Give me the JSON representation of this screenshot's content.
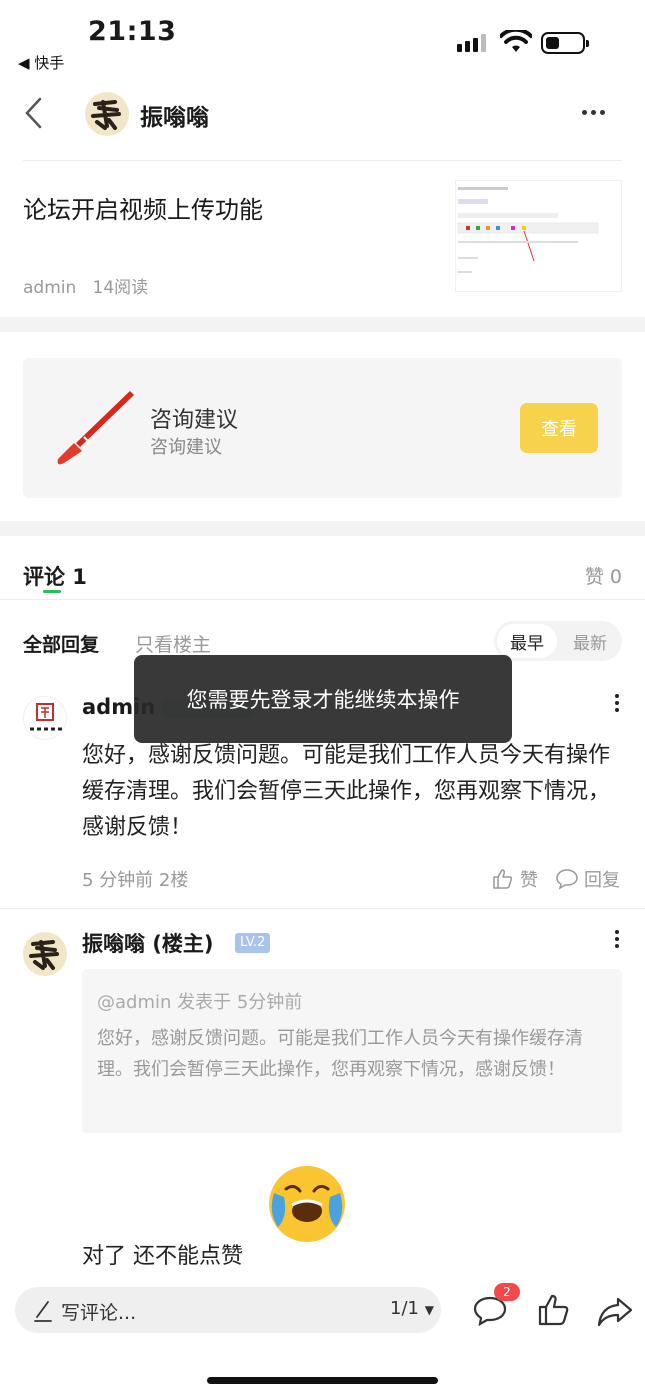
{
  "status_bar": {
    "time": "21:13",
    "back_app": "◀ 快手"
  },
  "header": {
    "user_name": "振嗡嗡"
  },
  "article": {
    "title": "论坛开启视频上传功能",
    "author": "admin",
    "reads": "14阅读"
  },
  "promo": {
    "title": "咨询建议",
    "subtitle": "咨询建议",
    "button": "查看"
  },
  "comments": {
    "tab_label": "评论 1",
    "likes_label": "赞 0",
    "filters": {
      "all": "全部回复",
      "owner_only": "只看楼主"
    },
    "sort": {
      "earliest": "最早",
      "latest": "最新"
    },
    "items": [
      {
        "name": "admin",
        "text": "您好，感谢反馈问题。可能是我们工作人员今天有操作缓存清理。我们会暂停三天此操作，您再观察下情况，感谢反馈！",
        "time_floor": "5 分钟前  2楼",
        "like_label": "赞",
        "reply_label": "回复"
      },
      {
        "name": "振嗡嗡 (楼主)",
        "level": "LV.2",
        "quote_head": "@admin 发表于 5分钟前",
        "quote_text": "您好，感谢反馈问题。可能是我们工作人员今天有操作缓存清理。我们会暂停三天此操作，您再观察下情况，感谢反馈！",
        "text": "对了 还不能点赞"
      }
    ]
  },
  "toast": "您需要先登录才能继续本操作",
  "bottom_bar": {
    "input_placeholder": "写评论...",
    "page": "1/1",
    "comment_badge": "2"
  },
  "colors": {
    "accent_green": "#2ebd59",
    "button_yellow": "#f7d34d",
    "badge_red": "#f24a4a",
    "level_blue": "#a9c3ea"
  }
}
